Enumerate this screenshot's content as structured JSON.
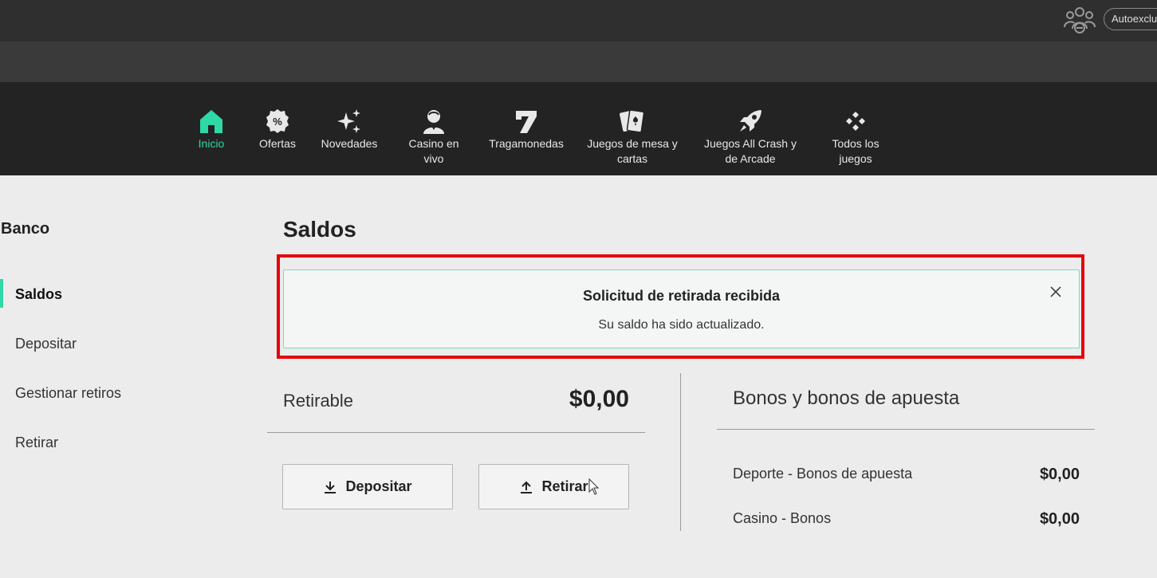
{
  "header": {
    "autoexclusion_label": "Autoexclu"
  },
  "nav": {
    "items": [
      {
        "label": "Inicio",
        "icon": "home-icon",
        "active": true
      },
      {
        "label": "Ofertas",
        "icon": "percent-badge-icon"
      },
      {
        "label": "Novedades",
        "icon": "sparkle-icon"
      },
      {
        "label": "Casino en vivo",
        "icon": "dealer-icon"
      },
      {
        "label": "Tragamonedas",
        "icon": "seven-icon"
      },
      {
        "label": "Juegos de mesa y cartas",
        "icon": "cards-icon"
      },
      {
        "label": "Juegos All Crash y de Arcade",
        "icon": "rocket-icon"
      },
      {
        "label": "Todos los juegos",
        "icon": "diamonds-grid-icon"
      }
    ]
  },
  "sidebar": {
    "title": "Banco",
    "items": [
      {
        "label": "Saldos",
        "active": true
      },
      {
        "label": "Depositar"
      },
      {
        "label": "Gestionar retiros"
      },
      {
        "label": "Retirar"
      }
    ]
  },
  "main": {
    "title": "Saldos",
    "notice": {
      "title": "Solicitud de retirada recibida",
      "text": "Su saldo ha sido actualizado."
    },
    "withdrawable": {
      "label": "Retirable",
      "value": "$0,00"
    },
    "buttons": {
      "deposit": "Depositar",
      "withdraw": "Retirar"
    },
    "bonuses": {
      "title": "Bonos y bonos de apuesta",
      "rows": [
        {
          "label": "Deporte - Bonos de apuesta",
          "value": "$0,00"
        },
        {
          "label": "Casino - Bonos",
          "value": "$0,00"
        }
      ]
    }
  },
  "colors": {
    "accent": "#2fd8a6",
    "highlight": "#e3050a",
    "nav_bg": "#232323"
  }
}
